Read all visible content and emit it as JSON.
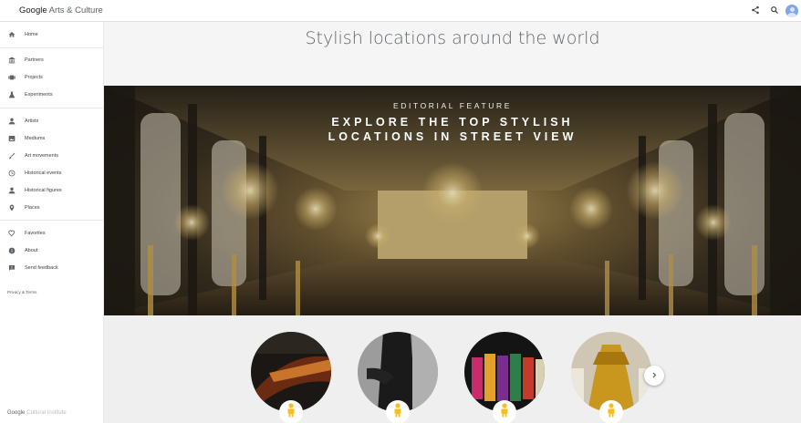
{
  "header": {
    "brand_google": "Google",
    "brand_product": "Arts & Culture",
    "actions": [
      "share-icon",
      "search-icon",
      "account-avatar"
    ]
  },
  "sidebar": {
    "groups": [
      [
        {
          "label": "Home",
          "icon": "home-icon"
        }
      ],
      [
        {
          "label": "Partners",
          "icon": "museum-icon"
        },
        {
          "label": "Projects",
          "icon": "projects-icon"
        },
        {
          "label": "Experiments",
          "icon": "flask-icon"
        }
      ],
      [
        {
          "label": "Artists",
          "icon": "person-icon"
        },
        {
          "label": "Mediums",
          "icon": "image-icon"
        },
        {
          "label": "Art movements",
          "icon": "brush-icon"
        },
        {
          "label": "Historical events",
          "icon": "clock-icon"
        },
        {
          "label": "Historical figures",
          "icon": "person-icon"
        },
        {
          "label": "Places",
          "icon": "place-pin-icon"
        }
      ],
      [
        {
          "label": "Favorites",
          "icon": "heart-icon"
        },
        {
          "label": "About",
          "icon": "info-icon"
        },
        {
          "label": "Send feedback",
          "icon": "feedback-icon"
        }
      ]
    ],
    "legal": {
      "privacy": "Privacy",
      "sep": " & ",
      "terms": "Terms"
    },
    "footer_google": "Google",
    "footer_product": "Cultural Institute"
  },
  "main": {
    "title": "Stylish locations around the world",
    "hero": {
      "kicker": "EDITORIAL FEATURE",
      "title_line1": "EXPLORE THE TOP STYLISH",
      "title_line2": "LOCATIONS IN STREET VIEW"
    },
    "carousel": {
      "items": [
        {
          "name": "red-lit-walkway",
          "badge": "pegman-icon"
        },
        {
          "name": "dark-suit-figure",
          "badge": "pegman-icon"
        },
        {
          "name": "colorful-dress-mannequins",
          "badge": "pegman-icon"
        },
        {
          "name": "gold-gown-exhibit",
          "badge": "pegman-icon"
        }
      ],
      "next_icon": "chevron-right-icon"
    }
  },
  "colors": {
    "accent_yellow": "#f9bd1d",
    "title_gray": "#5f6368",
    "avatar_blue": "#7fa8e8"
  }
}
